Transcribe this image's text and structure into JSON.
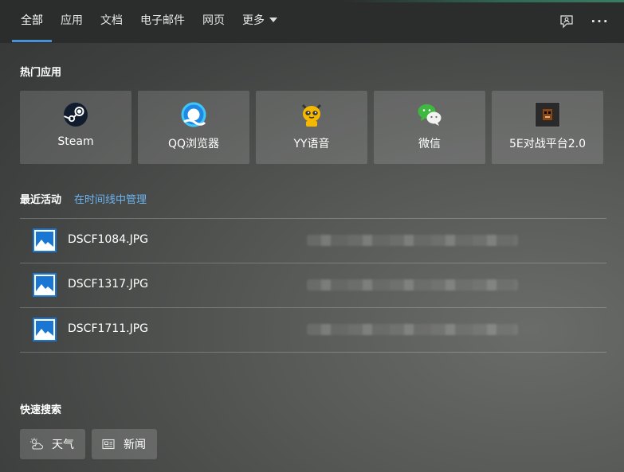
{
  "tabs": [
    {
      "label": "全部",
      "active": true
    },
    {
      "label": "应用"
    },
    {
      "label": "文档"
    },
    {
      "label": "电子邮件"
    },
    {
      "label": "网页"
    },
    {
      "label": "更多"
    }
  ],
  "top_apps": {
    "title": "热门应用",
    "items": [
      {
        "label": "Steam",
        "icon": "steam-icon"
      },
      {
        "label": "QQ浏览器",
        "icon": "qq-browser-icon"
      },
      {
        "label": "YY语音",
        "icon": "yy-voice-icon"
      },
      {
        "label": "微信",
        "icon": "wechat-icon"
      },
      {
        "label": "5E对战平台2.0",
        "icon": "5e-platform-icon"
      }
    ]
  },
  "recent": {
    "title": "最近活动",
    "manage_link": "在时间线中管理",
    "items": [
      {
        "name": "DSCF1084.JPG",
        "icon": "image-file-icon"
      },
      {
        "name": "DSCF1317.JPG",
        "icon": "image-file-icon"
      },
      {
        "name": "DSCF1711.JPG",
        "icon": "image-file-icon"
      }
    ]
  },
  "quick_search": {
    "title": "快速搜索",
    "items": [
      {
        "label": "天气",
        "icon": "weather-icon"
      },
      {
        "label": "新闻",
        "icon": "news-icon"
      }
    ]
  },
  "colors": {
    "accent": "#4a90d9",
    "link": "#6cb4f0"
  }
}
